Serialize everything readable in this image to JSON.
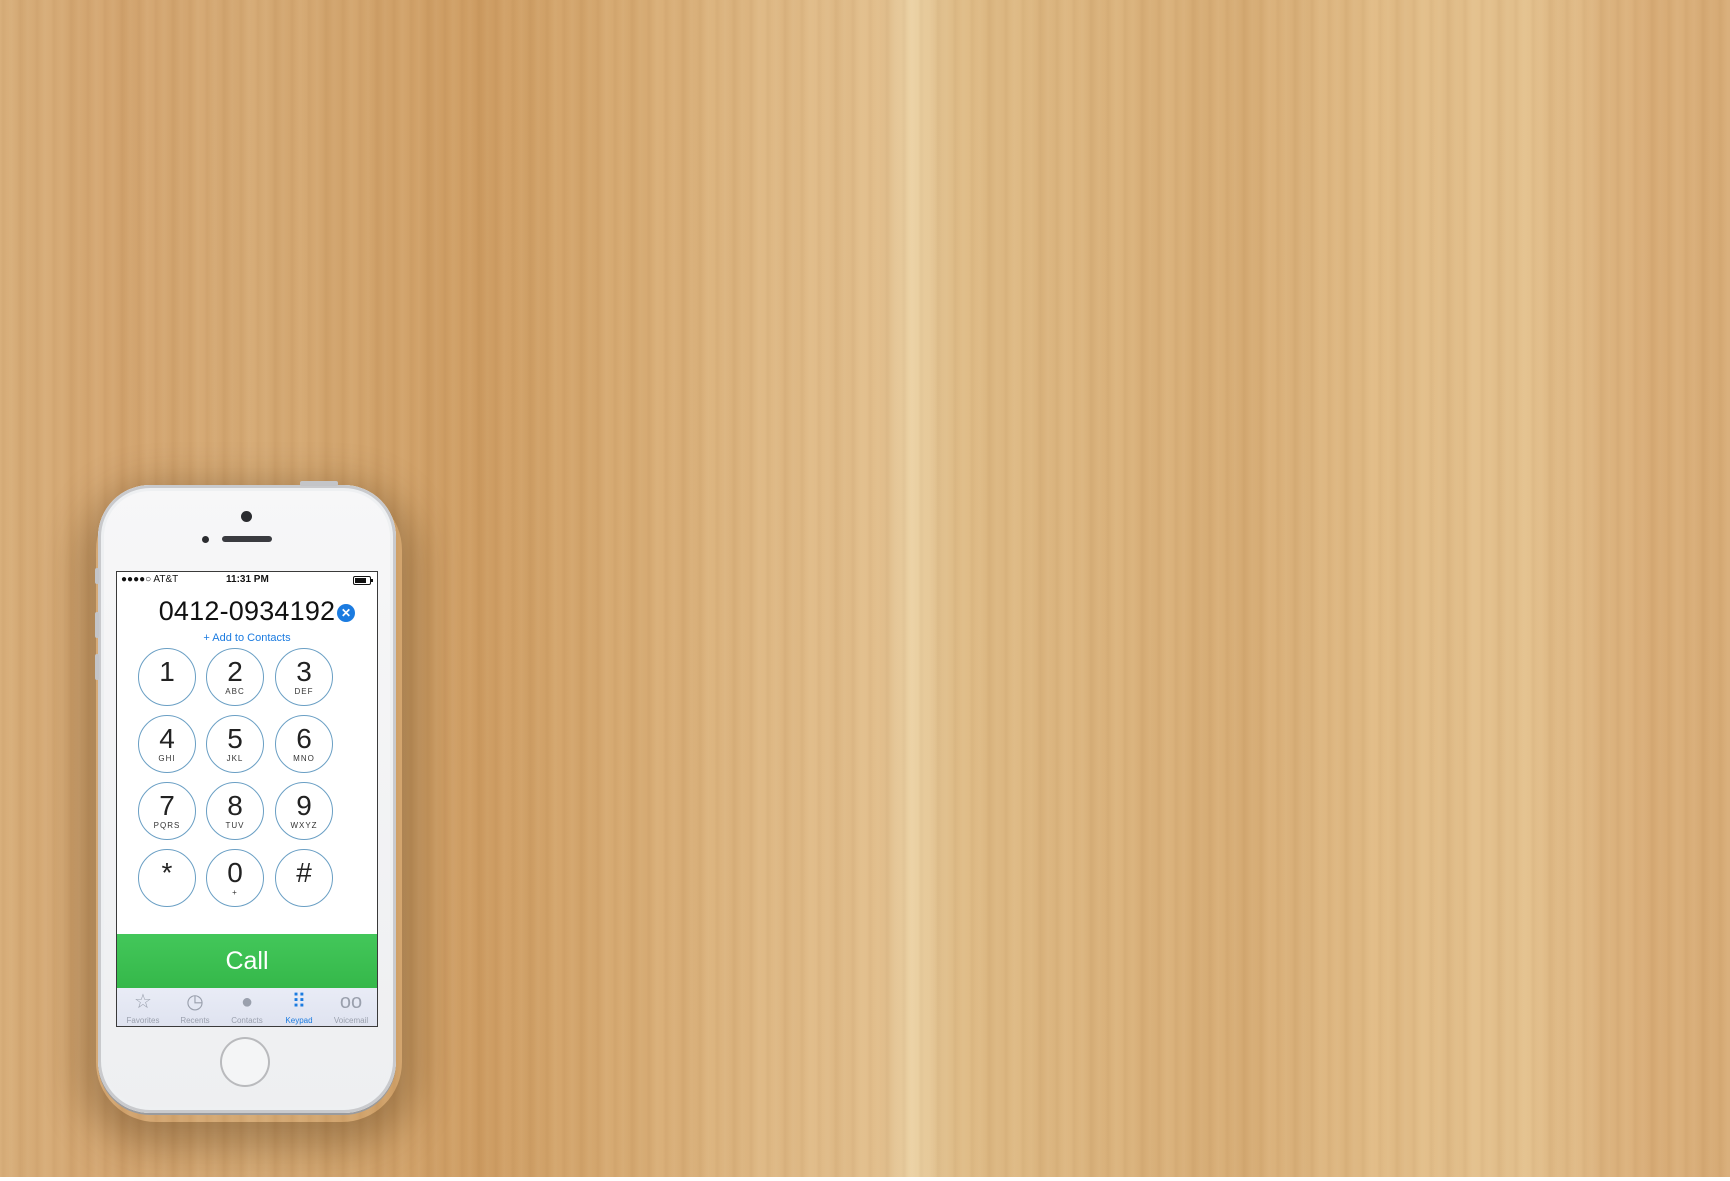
{
  "status_bar": {
    "carrier": "●●●●○ AT&T",
    "time": "11:31 PM"
  },
  "dialer": {
    "number": "0412-0934192",
    "add_to_contacts": "+ Add to Contacts",
    "call_label": "Call",
    "keys": [
      {
        "digit": "1",
        "letters": ""
      },
      {
        "digit": "2",
        "letters": "ABC"
      },
      {
        "digit": "3",
        "letters": "DEF"
      },
      {
        "digit": "4",
        "letters": "GHI"
      },
      {
        "digit": "5",
        "letters": "JKL"
      },
      {
        "digit": "6",
        "letters": "MNO"
      },
      {
        "digit": "7",
        "letters": "PQRS"
      },
      {
        "digit": "8",
        "letters": "TUV"
      },
      {
        "digit": "9",
        "letters": "WXYZ"
      },
      {
        "digit": "*",
        "letters": ""
      },
      {
        "digit": "0",
        "letters": "+"
      },
      {
        "digit": "#",
        "letters": ""
      }
    ]
  },
  "tabs": [
    {
      "label": "Favorites",
      "icon": "star-icon",
      "glyph": "☆",
      "active": false
    },
    {
      "label": "Recents",
      "icon": "clock-icon",
      "glyph": "◷",
      "active": false
    },
    {
      "label": "Contacts",
      "icon": "person-icon",
      "glyph": "●",
      "active": false
    },
    {
      "label": "Keypad",
      "icon": "keypad-icon",
      "glyph": "⠿",
      "active": true
    },
    {
      "label": "Voicemail",
      "icon": "voicemail-icon",
      "glyph": "oo",
      "active": false
    }
  ],
  "colors": {
    "accent": "#1b7be0",
    "call_green": "#3bbf50",
    "key_ring": "#6a9fc4"
  }
}
